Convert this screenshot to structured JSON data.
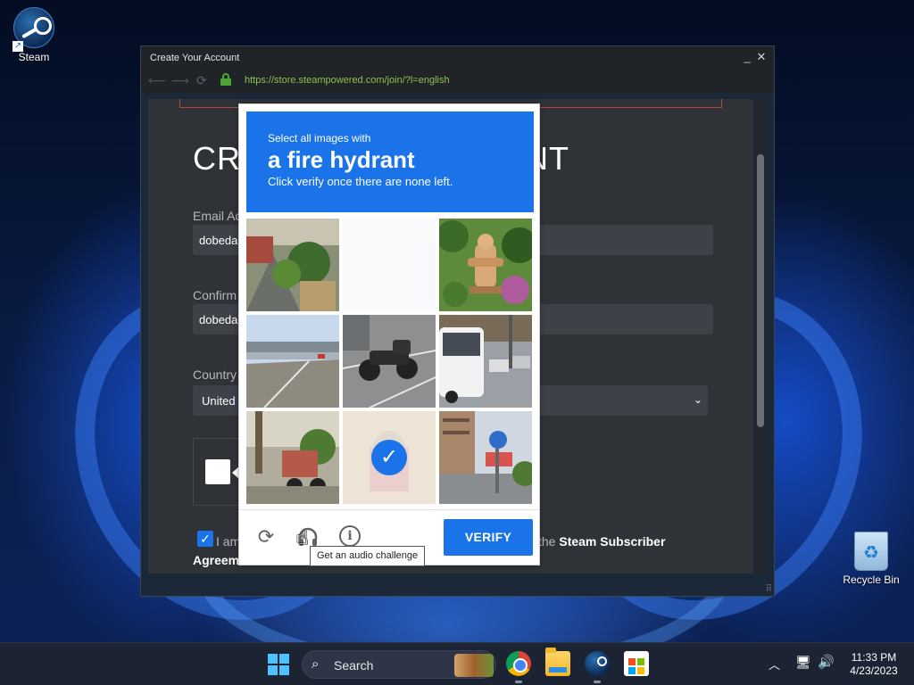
{
  "desktop": {
    "icons": [
      {
        "label": "Steam",
        "icon": "steam-icon"
      },
      {
        "label": "Recycle Bin",
        "icon": "recycle-bin-icon"
      }
    ]
  },
  "window": {
    "title": "Create Your Account",
    "minimize_glyph": "_",
    "close_glyph": "✕",
    "url": "https://store.steampowered.com/join/?l=english"
  },
  "form": {
    "heading_left": "CRE",
    "heading_right": "NT",
    "email_label": "Email Ad",
    "email_value": "dobeda",
    "confirm_label": "Confirm",
    "confirm_value": "dobeda",
    "country_label": "Country",
    "country_value": "United",
    "agree_text_1": "I am",
    "agree_text_2_prefix": "the",
    "agree_text_2_link": "Steam Subscriber",
    "agree_text_3": "Agreem"
  },
  "captcha": {
    "instruction_line1": "Select all images with",
    "instruction_target": "a fire hydrant",
    "instruction_line3": "Click verify once there are none left.",
    "verify_label": "VERIFY",
    "tooltip": "Get an audio challenge",
    "tiles": [
      {
        "scene": "street with plants and shop",
        "state": "normal"
      },
      {
        "scene": "blank loading",
        "state": "faded"
      },
      {
        "scene": "fire hydrant in garden",
        "state": "normal"
      },
      {
        "scene": "highway road",
        "state": "normal"
      },
      {
        "scene": "motorcycle in parking lot",
        "state": "normal"
      },
      {
        "scene": "white bus on street",
        "state": "normal"
      },
      {
        "scene": "street with scooter",
        "state": "normal"
      },
      {
        "scene": "selected tile",
        "state": "selected"
      },
      {
        "scene": "street with sign and buildings",
        "state": "normal"
      }
    ],
    "accent": "#1a73e8"
  },
  "taskbar": {
    "search_placeholder": "Search",
    "time": "11:33 PM",
    "date": "4/23/2023",
    "apps": [
      "chrome-icon",
      "file-explorer-icon",
      "steam-icon",
      "microsoft-store-icon"
    ]
  }
}
